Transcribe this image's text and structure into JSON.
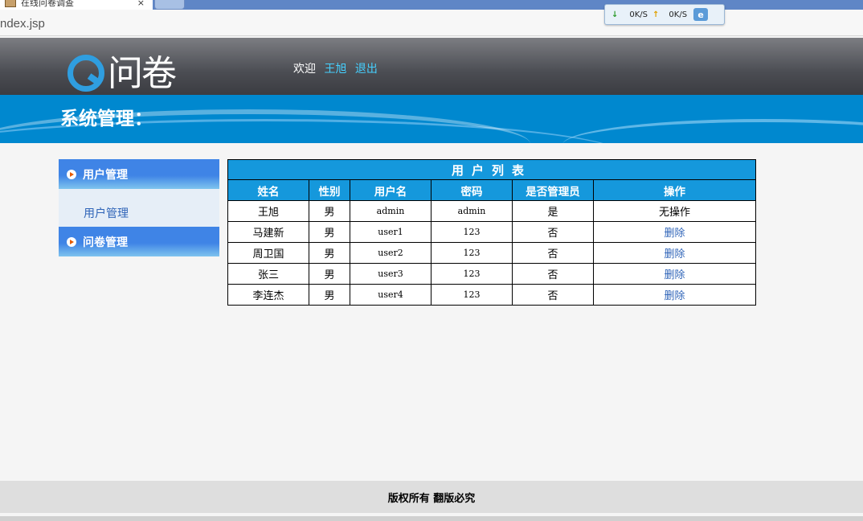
{
  "browser": {
    "tab_title": "在线问卷调查",
    "tab_close": "×",
    "address": "ndex.jsp",
    "speed_down": "0K/S",
    "speed_up": "0K/S",
    "speed_down_icon": "↓",
    "speed_up_icon": "↑",
    "ie_icon": "e"
  },
  "header": {
    "logo_text": "问卷",
    "welcome": "欢迎",
    "username": "王旭",
    "logout": "退出"
  },
  "banner": {
    "title": "系统管理："
  },
  "sidebar": {
    "sections": [
      {
        "label": "用户管理",
        "items": [
          "用户管理"
        ]
      },
      {
        "label": "问卷管理",
        "items": []
      }
    ]
  },
  "table": {
    "caption": "用户列表",
    "columns": [
      "姓名",
      "性别",
      "用户名",
      "密码",
      "是否管理员",
      "操作"
    ],
    "rows": [
      {
        "name": "王旭",
        "gender": "男",
        "username": "admin",
        "password": "admin",
        "is_admin": "是",
        "action": "无操作",
        "action_link": false
      },
      {
        "name": "马建新",
        "gender": "男",
        "username": "user1",
        "password": "123",
        "is_admin": "否",
        "action": "删除",
        "action_link": true
      },
      {
        "name": "周卫国",
        "gender": "男",
        "username": "user2",
        "password": "123",
        "is_admin": "否",
        "action": "删除",
        "action_link": true
      },
      {
        "name": "张三",
        "gender": "男",
        "username": "user3",
        "password": "123",
        "is_admin": "否",
        "action": "删除",
        "action_link": true
      },
      {
        "name": "李连杰",
        "gender": "男",
        "username": "user4",
        "password": "123",
        "is_admin": "否",
        "action": "删除",
        "action_link": true
      }
    ]
  },
  "footer": {
    "text": "版权所有 翻版必究"
  },
  "colors": {
    "header_bg": "#4b4d53",
    "banner_bg": "#0088cf",
    "table_header_bg": "#1598dc",
    "link": "#2f64b8",
    "welcome_link": "#45d0ff"
  }
}
